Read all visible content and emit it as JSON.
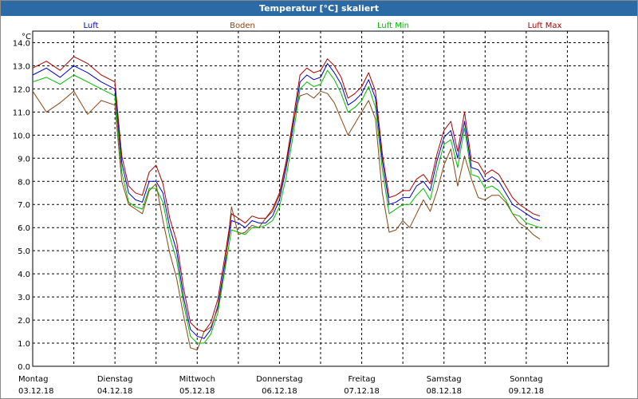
{
  "window": {
    "title": "Temperatur [°C] skaliert"
  },
  "chart_data": {
    "type": "line",
    "title": "Temperatur [°C] skaliert",
    "ylabel": "°C",
    "xlabel": "",
    "ylim": [
      0,
      14.5
    ],
    "xlim": [
      0,
      168
    ],
    "grid": true,
    "legend_placement": "top",
    "yticks": [
      0.0,
      1.0,
      2.0,
      3.0,
      4.0,
      5.0,
      6.0,
      7.0,
      8.0,
      9.0,
      10.0,
      11.0,
      12.0,
      13.0,
      14.0
    ],
    "ytick_labels": [
      "0.0",
      "1.0",
      "2.0",
      "3.0",
      "4.0",
      "5.0",
      "6.0",
      "7.0",
      "8.0",
      "9.0",
      "10.0",
      "11.0",
      "12.0",
      "13.0",
      "14.0"
    ],
    "x_day_starts": [
      0,
      24,
      48,
      72,
      96,
      120,
      144
    ],
    "xtick_labels": [
      {
        "day": "Montag",
        "date": "03.12.18"
      },
      {
        "day": "Dienstag",
        "date": "04.12.18"
      },
      {
        "day": "Mittwoch",
        "date": "05.12.18"
      },
      {
        "day": "Donnerstag",
        "date": "06.12.18"
      },
      {
        "day": "Freitag",
        "date": "07.12.18"
      },
      {
        "day": "Samstag",
        "date": "08.12.18"
      },
      {
        "day": "Sonntag",
        "date": "09.12.18"
      }
    ],
    "x": [
      0,
      4,
      8,
      12,
      16,
      20,
      24,
      26,
      28,
      30,
      32,
      34,
      36,
      38,
      40,
      42,
      44,
      46,
      48,
      50,
      52,
      54,
      56,
      58,
      60,
      62,
      64,
      66,
      68,
      70,
      72,
      74,
      76,
      78,
      80,
      82,
      84,
      86,
      88,
      90,
      92,
      94,
      96,
      98,
      100,
      102,
      104,
      106,
      108,
      110,
      112,
      114,
      116,
      118,
      120,
      122,
      124,
      126,
      128,
      130,
      132,
      134,
      136,
      138,
      140,
      142,
      144,
      146,
      148,
      150,
      152,
      154,
      156,
      158,
      160,
      162,
      164,
      166,
      168
    ],
    "series": [
      {
        "name": "Luft",
        "color": "#0000cc",
        "values": [
          12.6,
          12.9,
          12.5,
          13.0,
          12.7,
          12.3,
          12.0,
          8.8,
          7.5,
          7.2,
          7.1,
          8.0,
          8.0,
          7.5,
          6.0,
          5.0,
          3.0,
          1.6,
          1.3,
          1.2,
          1.6,
          2.6,
          4.4,
          6.3,
          6.2,
          6.0,
          6.3,
          6.2,
          6.2,
          6.5,
          7.2,
          8.6,
          10.4,
          12.3,
          12.6,
          12.4,
          12.5,
          13.1,
          12.7,
          12.2,
          11.3,
          11.5,
          11.8,
          12.4,
          11.6,
          8.9,
          7.0,
          7.1,
          7.3,
          7.3,
          7.8,
          8.0,
          7.6,
          8.9,
          9.9,
          10.2,
          9.0,
          10.6,
          8.6,
          8.5,
          8.0,
          8.2,
          8.0,
          7.5,
          7.0,
          6.8,
          6.6,
          6.4,
          6.3
        ]
      },
      {
        "name": "Boden",
        "color": "#8b4513",
        "values": [
          11.9,
          11.0,
          11.4,
          11.9,
          10.9,
          11.5,
          11.3,
          8.0,
          7.0,
          6.8,
          6.6,
          7.6,
          7.9,
          6.3,
          4.9,
          3.8,
          2.2,
          0.8,
          0.7,
          1.5,
          1.7,
          2.5,
          4.1,
          6.9,
          5.7,
          5.8,
          6.1,
          6.0,
          6.4,
          6.7,
          7.4,
          8.8,
          10.6,
          11.7,
          11.8,
          11.6,
          11.9,
          11.8,
          11.4,
          10.7,
          10.0,
          10.5,
          11.0,
          11.5,
          10.7,
          7.5,
          5.8,
          5.9,
          6.3,
          6.0,
          6.6,
          7.2,
          6.7,
          7.6,
          8.7,
          9.4,
          7.8,
          9.1,
          8.1,
          7.3,
          7.2,
          7.4,
          7.4,
          7.1,
          6.6,
          6.2,
          6.0,
          5.7,
          5.5
        ]
      },
      {
        "name": "Luft Min",
        "color": "#00bb00",
        "values": [
          12.3,
          12.5,
          12.2,
          12.6,
          12.3,
          12.0,
          11.7,
          8.4,
          7.1,
          6.9,
          6.8,
          7.7,
          7.7,
          7.1,
          5.6,
          4.6,
          2.7,
          1.3,
          1.0,
          1.0,
          1.4,
          2.3,
          4.1,
          5.9,
          5.8,
          5.7,
          6.0,
          6.0,
          6.1,
          6.3,
          6.9,
          8.2,
          10.0,
          12.0,
          12.3,
          12.1,
          12.2,
          12.8,
          12.4,
          11.8,
          11.0,
          11.2,
          11.5,
          12.1,
          11.2,
          8.5,
          6.6,
          6.8,
          7.0,
          7.0,
          7.4,
          7.7,
          7.2,
          8.5,
          9.6,
          9.8,
          8.6,
          10.3,
          8.3,
          8.2,
          7.7,
          7.8,
          7.6,
          7.2,
          6.6,
          6.5,
          6.2,
          6.1,
          6.0
        ]
      },
      {
        "name": "Luft Max",
        "color": "#aa0000",
        "values": [
          12.9,
          13.2,
          12.8,
          13.4,
          13.1,
          12.6,
          12.3,
          9.1,
          7.8,
          7.5,
          7.4,
          8.4,
          8.7,
          7.9,
          6.4,
          5.4,
          3.4,
          1.9,
          1.6,
          1.5,
          1.9,
          2.9,
          4.7,
          6.6,
          6.4,
          6.2,
          6.5,
          6.4,
          6.4,
          6.8,
          7.5,
          8.9,
          10.7,
          12.6,
          12.9,
          12.7,
          12.8,
          13.3,
          13.0,
          12.5,
          11.6,
          11.8,
          12.1,
          12.7,
          11.9,
          9.2,
          7.3,
          7.4,
          7.6,
          7.6,
          8.1,
          8.3,
          7.9,
          9.2,
          10.2,
          10.6,
          9.3,
          11.0,
          8.9,
          8.8,
          8.3,
          8.5,
          8.3,
          7.8,
          7.3,
          7.0,
          6.8,
          6.6,
          6.5
        ]
      }
    ]
  }
}
